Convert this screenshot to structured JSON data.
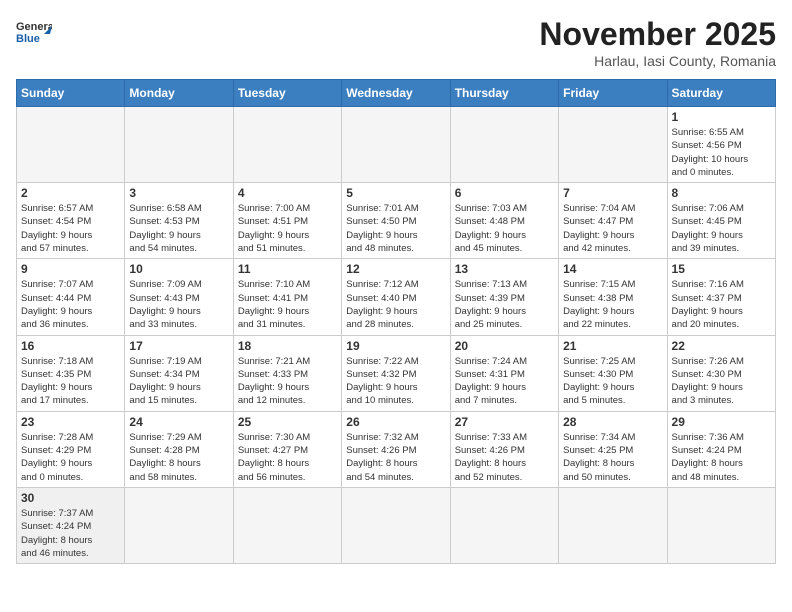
{
  "header": {
    "logo_general": "General",
    "logo_blue": "Blue",
    "month_year": "November 2025",
    "location": "Harlau, Iasi County, Romania"
  },
  "weekdays": [
    "Sunday",
    "Monday",
    "Tuesday",
    "Wednesday",
    "Thursday",
    "Friday",
    "Saturday"
  ],
  "weeks": [
    [
      {
        "day": "",
        "info": ""
      },
      {
        "day": "",
        "info": ""
      },
      {
        "day": "",
        "info": ""
      },
      {
        "day": "",
        "info": ""
      },
      {
        "day": "",
        "info": ""
      },
      {
        "day": "",
        "info": ""
      },
      {
        "day": "1",
        "info": "Sunrise: 6:55 AM\nSunset: 4:56 PM\nDaylight: 10 hours\nand 0 minutes."
      }
    ],
    [
      {
        "day": "2",
        "info": "Sunrise: 6:57 AM\nSunset: 4:54 PM\nDaylight: 9 hours\nand 57 minutes."
      },
      {
        "day": "3",
        "info": "Sunrise: 6:58 AM\nSunset: 4:53 PM\nDaylight: 9 hours\nand 54 minutes."
      },
      {
        "day": "4",
        "info": "Sunrise: 7:00 AM\nSunset: 4:51 PM\nDaylight: 9 hours\nand 51 minutes."
      },
      {
        "day": "5",
        "info": "Sunrise: 7:01 AM\nSunset: 4:50 PM\nDaylight: 9 hours\nand 48 minutes."
      },
      {
        "day": "6",
        "info": "Sunrise: 7:03 AM\nSunset: 4:48 PM\nDaylight: 9 hours\nand 45 minutes."
      },
      {
        "day": "7",
        "info": "Sunrise: 7:04 AM\nSunset: 4:47 PM\nDaylight: 9 hours\nand 42 minutes."
      },
      {
        "day": "8",
        "info": "Sunrise: 7:06 AM\nSunset: 4:45 PM\nDaylight: 9 hours\nand 39 minutes."
      }
    ],
    [
      {
        "day": "9",
        "info": "Sunrise: 7:07 AM\nSunset: 4:44 PM\nDaylight: 9 hours\nand 36 minutes."
      },
      {
        "day": "10",
        "info": "Sunrise: 7:09 AM\nSunset: 4:43 PM\nDaylight: 9 hours\nand 33 minutes."
      },
      {
        "day": "11",
        "info": "Sunrise: 7:10 AM\nSunset: 4:41 PM\nDaylight: 9 hours\nand 31 minutes."
      },
      {
        "day": "12",
        "info": "Sunrise: 7:12 AM\nSunset: 4:40 PM\nDaylight: 9 hours\nand 28 minutes."
      },
      {
        "day": "13",
        "info": "Sunrise: 7:13 AM\nSunset: 4:39 PM\nDaylight: 9 hours\nand 25 minutes."
      },
      {
        "day": "14",
        "info": "Sunrise: 7:15 AM\nSunset: 4:38 PM\nDaylight: 9 hours\nand 22 minutes."
      },
      {
        "day": "15",
        "info": "Sunrise: 7:16 AM\nSunset: 4:37 PM\nDaylight: 9 hours\nand 20 minutes."
      }
    ],
    [
      {
        "day": "16",
        "info": "Sunrise: 7:18 AM\nSunset: 4:35 PM\nDaylight: 9 hours\nand 17 minutes."
      },
      {
        "day": "17",
        "info": "Sunrise: 7:19 AM\nSunset: 4:34 PM\nDaylight: 9 hours\nand 15 minutes."
      },
      {
        "day": "18",
        "info": "Sunrise: 7:21 AM\nSunset: 4:33 PM\nDaylight: 9 hours\nand 12 minutes."
      },
      {
        "day": "19",
        "info": "Sunrise: 7:22 AM\nSunset: 4:32 PM\nDaylight: 9 hours\nand 10 minutes."
      },
      {
        "day": "20",
        "info": "Sunrise: 7:24 AM\nSunset: 4:31 PM\nDaylight: 9 hours\nand 7 minutes."
      },
      {
        "day": "21",
        "info": "Sunrise: 7:25 AM\nSunset: 4:30 PM\nDaylight: 9 hours\nand 5 minutes."
      },
      {
        "day": "22",
        "info": "Sunrise: 7:26 AM\nSunset: 4:30 PM\nDaylight: 9 hours\nand 3 minutes."
      }
    ],
    [
      {
        "day": "23",
        "info": "Sunrise: 7:28 AM\nSunset: 4:29 PM\nDaylight: 9 hours\nand 0 minutes."
      },
      {
        "day": "24",
        "info": "Sunrise: 7:29 AM\nSunset: 4:28 PM\nDaylight: 8 hours\nand 58 minutes."
      },
      {
        "day": "25",
        "info": "Sunrise: 7:30 AM\nSunset: 4:27 PM\nDaylight: 8 hours\nand 56 minutes."
      },
      {
        "day": "26",
        "info": "Sunrise: 7:32 AM\nSunset: 4:26 PM\nDaylight: 8 hours\nand 54 minutes."
      },
      {
        "day": "27",
        "info": "Sunrise: 7:33 AM\nSunset: 4:26 PM\nDaylight: 8 hours\nand 52 minutes."
      },
      {
        "day": "28",
        "info": "Sunrise: 7:34 AM\nSunset: 4:25 PM\nDaylight: 8 hours\nand 50 minutes."
      },
      {
        "day": "29",
        "info": "Sunrise: 7:36 AM\nSunset: 4:24 PM\nDaylight: 8 hours\nand 48 minutes."
      }
    ],
    [
      {
        "day": "30",
        "info": "Sunrise: 7:37 AM\nSunset: 4:24 PM\nDaylight: 8 hours\nand 46 minutes."
      },
      {
        "day": "",
        "info": ""
      },
      {
        "day": "",
        "info": ""
      },
      {
        "day": "",
        "info": ""
      },
      {
        "day": "",
        "info": ""
      },
      {
        "day": "",
        "info": ""
      },
      {
        "day": "",
        "info": ""
      }
    ]
  ]
}
